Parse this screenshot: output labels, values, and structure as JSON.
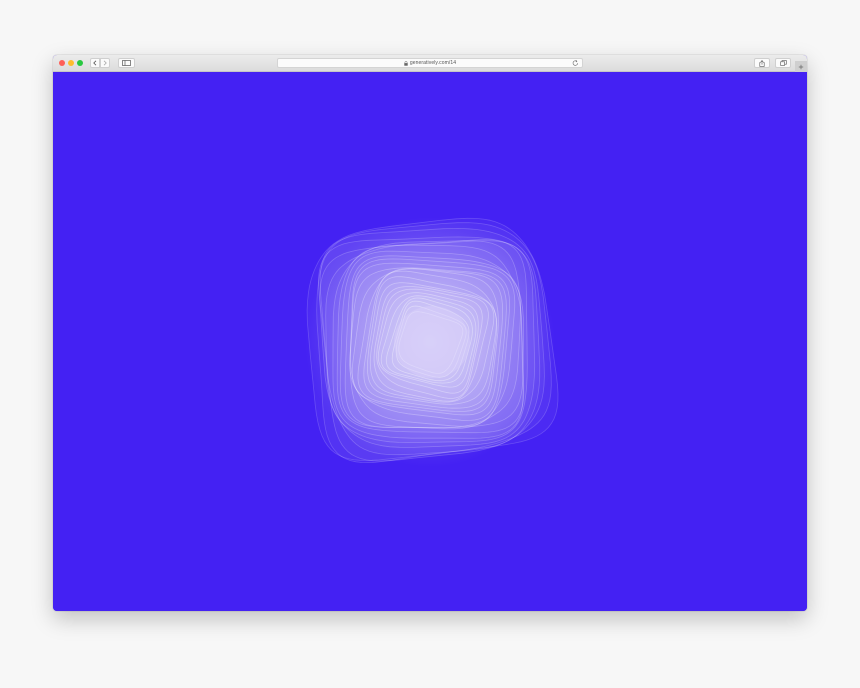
{
  "browser": {
    "url": "generatively.com/14",
    "traffic_lights": {
      "close": "#fe5f57",
      "minimize": "#febc2e",
      "maximize": "#28c840"
    },
    "icons": {
      "back": "chevron-left-icon",
      "forward": "chevron-right-icon",
      "sidebar": "sidebar-icon",
      "lock": "lock-icon",
      "reload": "reload-icon",
      "share": "share-icon",
      "tabs": "tabs-overview-icon",
      "new_tab": "plus-icon"
    }
  },
  "page": {
    "background": "#4421f3",
    "artwork_stroke": "#ffffff",
    "artwork_glow": "#d9d0fb"
  }
}
